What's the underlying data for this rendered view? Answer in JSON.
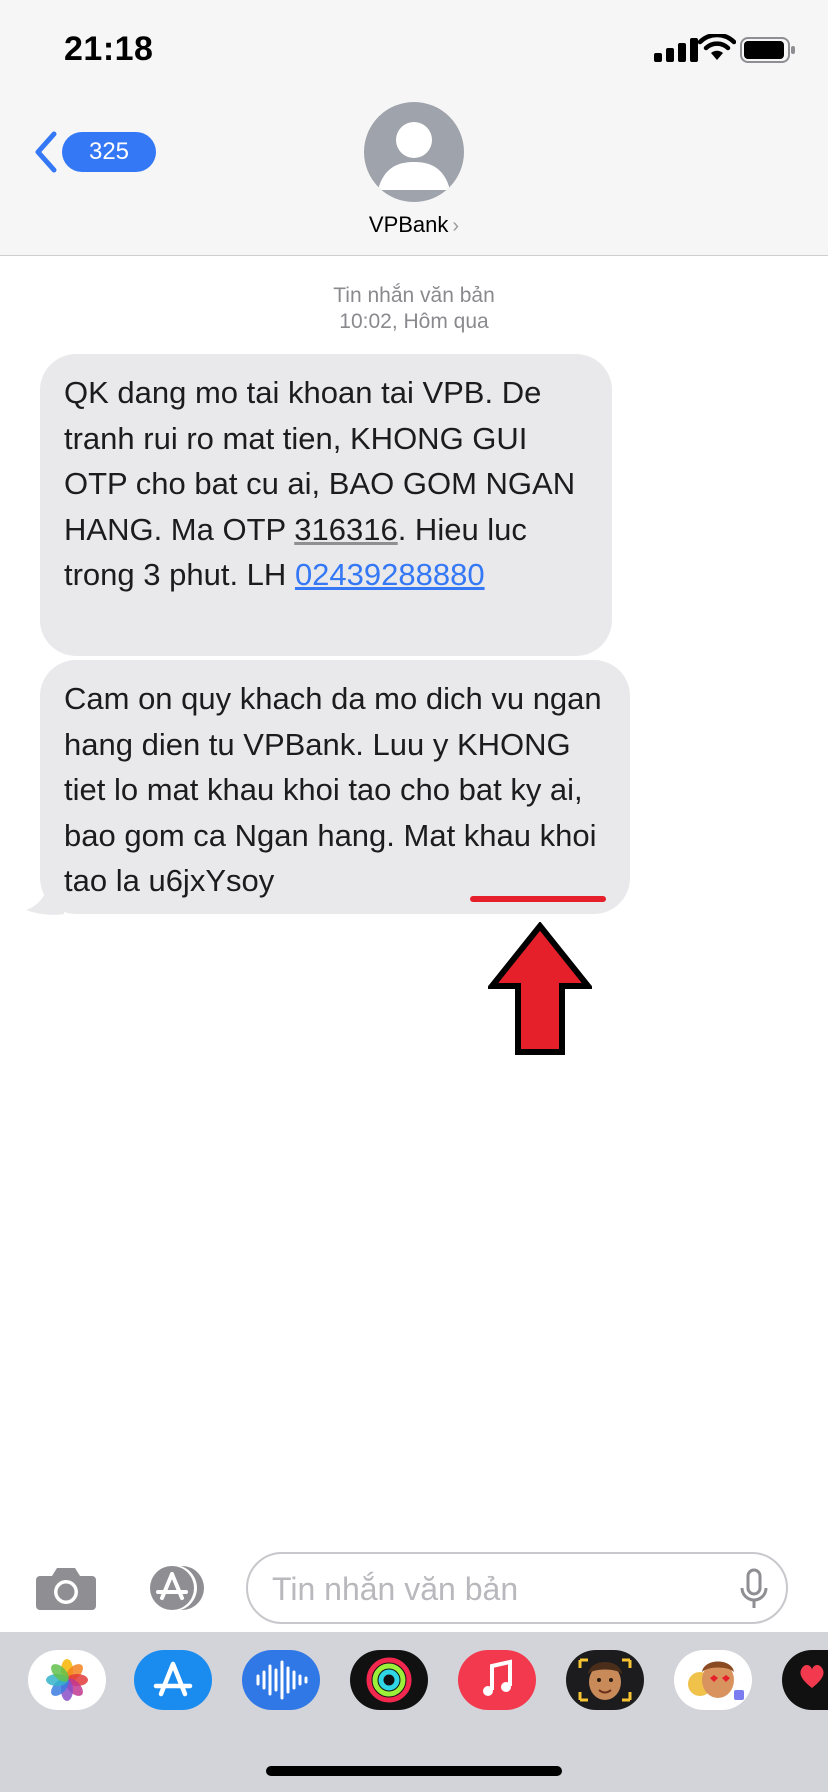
{
  "status_bar": {
    "time": "21:18"
  },
  "nav": {
    "back_badge": "325",
    "contact_name": "VPBank",
    "contact_chevron": "›"
  },
  "thread": {
    "type_label": "Tin nhắn văn bản",
    "timestamp": "10:02, Hôm qua"
  },
  "messages": [
    {
      "pre": "QK dang mo tai khoan tai VPB. De tranh rui ro mat tien, KHONG GUI OTP cho bat cu ai, BAO GOM NGAN HANG. Ma OTP ",
      "otp": "316316",
      "mid": ". Hieu luc trong 3 phut. LH ",
      "phone": "02439288880"
    },
    {
      "pre": "Cam on quy khach da mo dich vu ngan hang dien tu VPBank. Luu y KHONG tiet lo mat khau khoi tao cho bat ky ai, bao gom ca Ngan hang. Mat khau khoi tao la ",
      "password": "u6jxYsoy"
    }
  ],
  "annotation": {
    "color": "#e5202a",
    "arrow_icon": "red-up-arrow"
  },
  "compose": {
    "placeholder": "Tin nhắn văn bản"
  },
  "colors": {
    "accent": "#3478f6",
    "bubble": "#e9e9eb",
    "drawer": "#d3d4d9"
  },
  "app_drawer": [
    "photos-app",
    "app-store-app",
    "audio-app",
    "activity-app",
    "music-app",
    "memoji-app",
    "memoji-stickers-app",
    "digital-touch-app"
  ]
}
